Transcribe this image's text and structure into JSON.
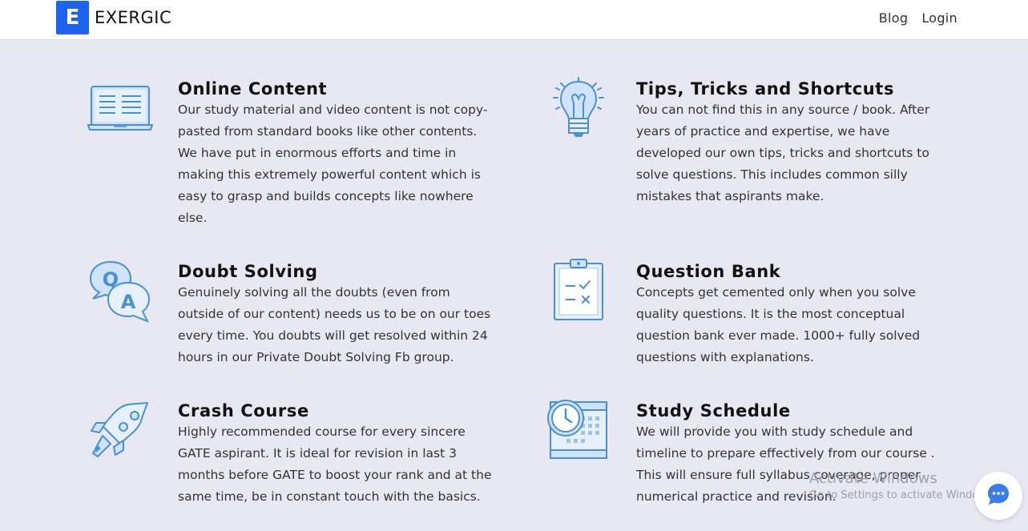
{
  "brand": {
    "logo_letter": "E",
    "name": "EXERGIC"
  },
  "nav": {
    "blog": "Blog",
    "login": "Login"
  },
  "features": [
    {
      "icon": "laptop-document-icon",
      "title": "Online Content",
      "desc": "Our study material and video content is not copy-pasted from standard books like other contents. We have put in enormous efforts and time in making this extremely powerful content which is easy to grasp and builds concepts like nowhere else."
    },
    {
      "icon": "lightbulb-icon",
      "title": "Tips, Tricks and Shortcuts",
      "desc": "You can not find this in any source / book. After years of practice and expertise, we have developed our own tips, tricks and shortcuts to solve questions. This includes common silly mistakes that aspirants make."
    },
    {
      "icon": "qa-chat-icon",
      "title": "Doubt Solving",
      "desc": "Genuinely solving all the doubts (even from outside of our content) needs us to be on our toes every time. You doubts will get resolved within 24 hours in our Private Doubt Solving Fb group."
    },
    {
      "icon": "clipboard-checklist-icon",
      "title": "Question Bank",
      "desc": "Concepts get cemented only when you solve quality questions. It is the most conceptual question bank ever made. 1000+ fully solved questions with explanations."
    },
    {
      "icon": "rocket-icon",
      "title": "Crash Course",
      "desc": "Highly recommended course for every sincere GATE aspirant. It is ideal for revision in last 3 months before GATE to boost your rank and at the same time, be in constant touch with the basics."
    },
    {
      "icon": "clock-calendar-icon",
      "title": "Study Schedule",
      "desc": "We will provide you with study schedule and timeline to prepare effectively from our course . This will ensure full syllabus coverage, proper numerical practice and revision."
    }
  ],
  "watermark": {
    "title": "Activate Windows",
    "subtitle": "Go to Settings to activate Windows."
  },
  "chat": {
    "icon": "chat-bubble-icon"
  },
  "colors": {
    "brand_blue": "#1c63f2",
    "icon_blue": "#4a90d9",
    "page_bg": "#e7e8f2"
  }
}
